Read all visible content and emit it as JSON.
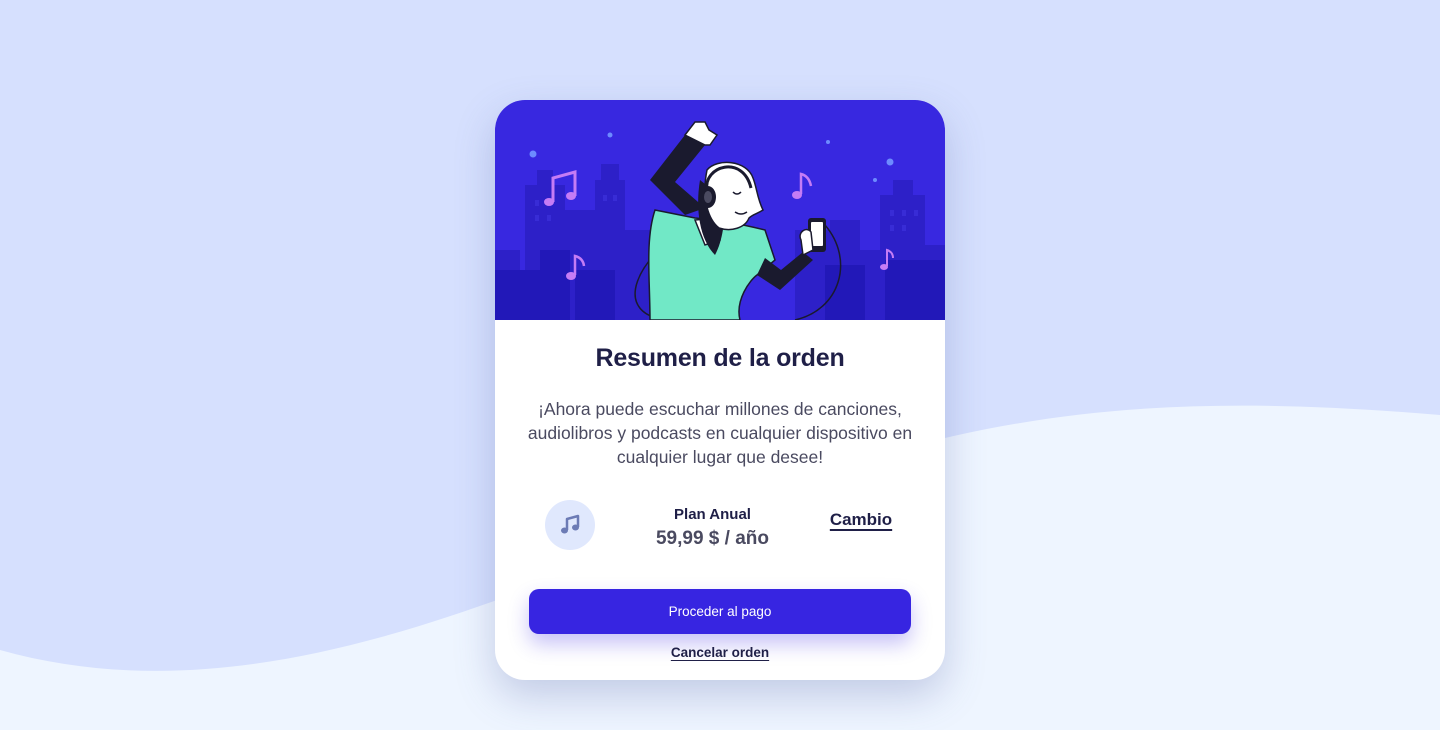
{
  "colors": {
    "page_background": "#d6e0fe",
    "wave_background": "#eef5ff",
    "card_background": "#ffffff",
    "hero_background": "#3828e0",
    "primary_button": "#3725e1",
    "dark_text": "#1f1f47",
    "body_text": "#4a4a60",
    "icon_circle": "#e0e8fd"
  },
  "hero": {
    "illustration": "person-listening-music-illustration",
    "icons": [
      "music-note-icon",
      "city-skyline",
      "headphones",
      "smartphone"
    ]
  },
  "order_summary": {
    "title": "Resumen de la orden",
    "description": "¡Ahora puede escuchar millones de canciones, audiolibros y podcasts en cualquier dispositivo en cualquier lugar que desee!"
  },
  "plan": {
    "icon": "music-note-icon",
    "name": "Plan Anual",
    "price": "59,99 $ / año",
    "change_label": "Cambio"
  },
  "actions": {
    "proceed_label": "Proceder al pago",
    "cancel_label": "Cancelar orden"
  }
}
